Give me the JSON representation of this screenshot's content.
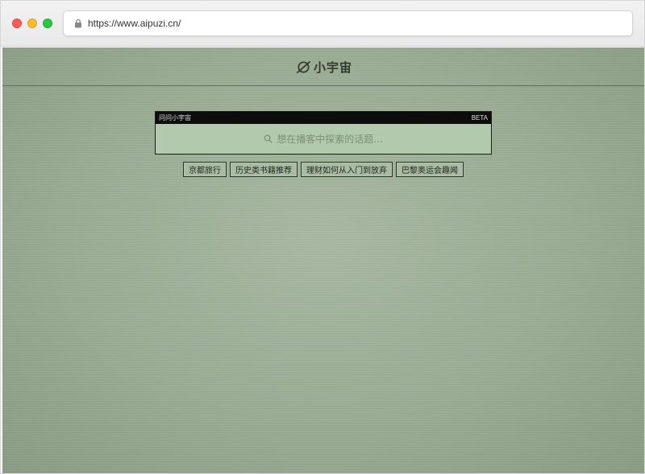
{
  "browser": {
    "url": "https://www.aipuzi.cn/"
  },
  "header": {
    "logo_text": "小宇宙"
  },
  "search": {
    "top_left": "问问小宇宙",
    "top_right": "BETA",
    "placeholder": "想在播客中探索的话题..."
  },
  "suggestions": [
    {
      "label": "京都旅行"
    },
    {
      "label": "历史类书籍推荐"
    },
    {
      "label": "理财如何从入门到放弃"
    },
    {
      "label": "巴黎奥运会趣闻"
    }
  ],
  "colors": {
    "page_bg": "#9aac94",
    "search_bg": "#b3c9ad",
    "search_bar": "#0c0d0c",
    "chip_bg": "#a9bca3",
    "text_dark": "#2f3a2c"
  },
  "icons": {
    "lock": "lock-icon",
    "logo": "planet-logo-icon",
    "search": "search-icon"
  }
}
